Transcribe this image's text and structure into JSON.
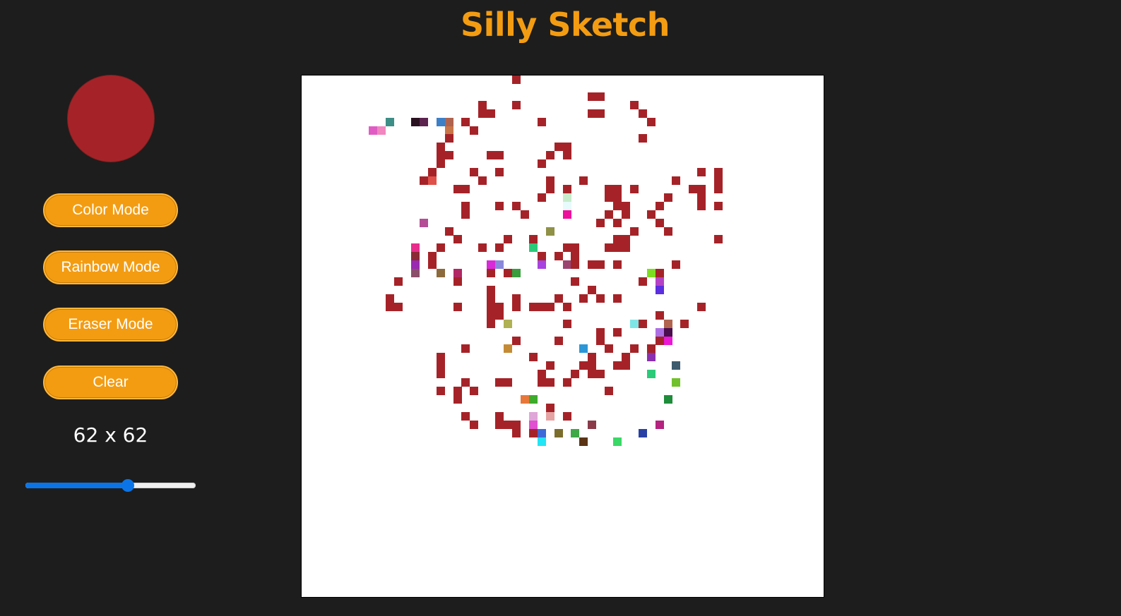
{
  "app": {
    "title": "Silly Sketch"
  },
  "sidebar": {
    "current_color": "#a52328",
    "buttons": {
      "color_mode": "Color Mode",
      "rainbow_mode": "Rainbow Mode",
      "eraser_mode": "Eraser Mode",
      "clear": "Clear"
    },
    "grid_size_label": "62 x 62",
    "grid_size_value": 62,
    "slider_fraction": 0.6
  },
  "theme": {
    "background": "#1d1d1d",
    "accent": "#f39c12",
    "canvas_background": "#ffffff",
    "brush_color": "#a52328",
    "slider_color": "#0b75e7"
  },
  "canvas": {
    "grid_size": 62,
    "painted_cells": [
      [
        25,
        0,
        "#a52328"
      ],
      [
        34,
        2,
        "#a52328"
      ],
      [
        35,
        2,
        "#a52328"
      ],
      [
        21,
        3,
        "#a52328"
      ],
      [
        25,
        3,
        "#a52328"
      ],
      [
        39,
        3,
        "#a52328"
      ],
      [
        21,
        4,
        "#a52328"
      ],
      [
        22,
        4,
        "#a52328"
      ],
      [
        34,
        4,
        "#a52328"
      ],
      [
        35,
        4,
        "#a52328"
      ],
      [
        40,
        4,
        "#a52328"
      ],
      [
        10,
        5,
        "#3d8e86"
      ],
      [
        13,
        5,
        "#2a1121"
      ],
      [
        14,
        5,
        "#5c234f"
      ],
      [
        16,
        5,
        "#3d80c7"
      ],
      [
        17,
        5,
        "#b0634f"
      ],
      [
        19,
        5,
        "#a52328"
      ],
      [
        28,
        5,
        "#a52328"
      ],
      [
        41,
        5,
        "#a52328"
      ],
      [
        8,
        6,
        "#e05cc4"
      ],
      [
        9,
        6,
        "#f186c0"
      ],
      [
        17,
        6,
        "#c87548"
      ],
      [
        20,
        6,
        "#a52328"
      ],
      [
        17,
        7,
        "#a52328"
      ],
      [
        40,
        7,
        "#a52328"
      ],
      [
        16,
        8,
        "#a52328"
      ],
      [
        30,
        8,
        "#a52328"
      ],
      [
        31,
        8,
        "#a52328"
      ],
      [
        16,
        9,
        "#a52328"
      ],
      [
        17,
        9,
        "#a52328"
      ],
      [
        22,
        9,
        "#a52328"
      ],
      [
        23,
        9,
        "#a52328"
      ],
      [
        29,
        9,
        "#a52328"
      ],
      [
        31,
        9,
        "#a52328"
      ],
      [
        16,
        10,
        "#a52328"
      ],
      [
        28,
        10,
        "#a52328"
      ],
      [
        15,
        11,
        "#a52328"
      ],
      [
        20,
        11,
        "#a52328"
      ],
      [
        23,
        11,
        "#a52328"
      ],
      [
        47,
        11,
        "#a52328"
      ],
      [
        49,
        11,
        "#a52328"
      ],
      [
        14,
        12,
        "#a52328"
      ],
      [
        15,
        12,
        "#e0504a"
      ],
      [
        21,
        12,
        "#a52328"
      ],
      [
        29,
        12,
        "#a52328"
      ],
      [
        33,
        12,
        "#a52328"
      ],
      [
        44,
        12,
        "#a52328"
      ],
      [
        49,
        12,
        "#a52328"
      ],
      [
        18,
        13,
        "#a52328"
      ],
      [
        19,
        13,
        "#a52328"
      ],
      [
        29,
        13,
        "#a52328"
      ],
      [
        31,
        13,
        "#a52328"
      ],
      [
        36,
        13,
        "#a52328"
      ],
      [
        37,
        13,
        "#a52328"
      ],
      [
        39,
        13,
        "#a52328"
      ],
      [
        46,
        13,
        "#a52328"
      ],
      [
        47,
        13,
        "#a52328"
      ],
      [
        49,
        13,
        "#a52328"
      ],
      [
        28,
        14,
        "#a52328"
      ],
      [
        31,
        14,
        "#c8eccb"
      ],
      [
        36,
        14,
        "#a52328"
      ],
      [
        37,
        14,
        "#a52328"
      ],
      [
        43,
        14,
        "#a52328"
      ],
      [
        47,
        14,
        "#a52328"
      ],
      [
        19,
        15,
        "#a52328"
      ],
      [
        23,
        15,
        "#a52328"
      ],
      [
        25,
        15,
        "#a52328"
      ],
      [
        31,
        15,
        "#e7fafc"
      ],
      [
        37,
        15,
        "#a52328"
      ],
      [
        38,
        15,
        "#a52328"
      ],
      [
        42,
        15,
        "#a52328"
      ],
      [
        47,
        15,
        "#a52328"
      ],
      [
        49,
        15,
        "#a52328"
      ],
      [
        19,
        16,
        "#a52328"
      ],
      [
        26,
        16,
        "#a52328"
      ],
      [
        31,
        16,
        "#ee109d"
      ],
      [
        36,
        16,
        "#a52328"
      ],
      [
        38,
        16,
        "#a52328"
      ],
      [
        41,
        16,
        "#a52328"
      ],
      [
        14,
        17,
        "#b44d95"
      ],
      [
        35,
        17,
        "#a52328"
      ],
      [
        37,
        17,
        "#a52328"
      ],
      [
        42,
        17,
        "#a52328"
      ],
      [
        17,
        18,
        "#a52328"
      ],
      [
        29,
        18,
        "#8f9146"
      ],
      [
        39,
        18,
        "#a52328"
      ],
      [
        43,
        18,
        "#a52328"
      ],
      [
        18,
        19,
        "#a52328"
      ],
      [
        24,
        19,
        "#a52328"
      ],
      [
        27,
        19,
        "#a52328"
      ],
      [
        37,
        19,
        "#a52328"
      ],
      [
        38,
        19,
        "#a52328"
      ],
      [
        49,
        19,
        "#a52328"
      ],
      [
        13,
        20,
        "#e82d8d"
      ],
      [
        16,
        20,
        "#a52328"
      ],
      [
        21,
        20,
        "#a52328"
      ],
      [
        23,
        20,
        "#a52328"
      ],
      [
        27,
        20,
        "#2bca79"
      ],
      [
        31,
        20,
        "#a52328"
      ],
      [
        32,
        20,
        "#a52328"
      ],
      [
        36,
        20,
        "#a52328"
      ],
      [
        37,
        20,
        "#a52328"
      ],
      [
        38,
        20,
        "#a52328"
      ],
      [
        13,
        21,
        "#8b2a34"
      ],
      [
        15,
        21,
        "#a52328"
      ],
      [
        28,
        21,
        "#a52328"
      ],
      [
        30,
        21,
        "#a52328"
      ],
      [
        32,
        21,
        "#a52328"
      ],
      [
        13,
        22,
        "#9a2ab2"
      ],
      [
        15,
        22,
        "#a52328"
      ],
      [
        22,
        22,
        "#d82ad9"
      ],
      [
        23,
        22,
        "#8a88dc"
      ],
      [
        28,
        22,
        "#a842e0"
      ],
      [
        31,
        22,
        "#9b4472"
      ],
      [
        32,
        22,
        "#a52328"
      ],
      [
        34,
        22,
        "#a52328"
      ],
      [
        35,
        22,
        "#a52328"
      ],
      [
        37,
        22,
        "#a52328"
      ],
      [
        44,
        22,
        "#a52328"
      ],
      [
        13,
        23,
        "#8b4e6a"
      ],
      [
        16,
        23,
        "#8d6a3b"
      ],
      [
        18,
        23,
        "#b22864"
      ],
      [
        22,
        23,
        "#a52328"
      ],
      [
        24,
        23,
        "#a52328"
      ],
      [
        25,
        23,
        "#3a9d3e"
      ],
      [
        41,
        23,
        "#7dde21"
      ],
      [
        42,
        23,
        "#a52328"
      ],
      [
        11,
        24,
        "#a52328"
      ],
      [
        18,
        24,
        "#a52328"
      ],
      [
        32,
        24,
        "#a52328"
      ],
      [
        40,
        24,
        "#a52328"
      ],
      [
        42,
        24,
        "#b542c5"
      ],
      [
        22,
        25,
        "#a52328"
      ],
      [
        34,
        25,
        "#a52328"
      ],
      [
        42,
        25,
        "#5b2ee0"
      ],
      [
        10,
        26,
        "#a52328"
      ],
      [
        22,
        26,
        "#a52328"
      ],
      [
        25,
        26,
        "#a52328"
      ],
      [
        30,
        26,
        "#a52328"
      ],
      [
        33,
        26,
        "#a52328"
      ],
      [
        35,
        26,
        "#a52328"
      ],
      [
        37,
        26,
        "#a52328"
      ],
      [
        10,
        27,
        "#a52328"
      ],
      [
        11,
        27,
        "#a52328"
      ],
      [
        18,
        27,
        "#a52328"
      ],
      [
        22,
        27,
        "#a52328"
      ],
      [
        23,
        27,
        "#a52328"
      ],
      [
        25,
        27,
        "#a52328"
      ],
      [
        27,
        27,
        "#a52328"
      ],
      [
        28,
        27,
        "#a52328"
      ],
      [
        29,
        27,
        "#a52328"
      ],
      [
        31,
        27,
        "#a52328"
      ],
      [
        47,
        27,
        "#a52328"
      ],
      [
        22,
        28,
        "#a52328"
      ],
      [
        23,
        28,
        "#a52328"
      ],
      [
        42,
        28,
        "#a52328"
      ],
      [
        22,
        29,
        "#a52328"
      ],
      [
        24,
        29,
        "#b0b152"
      ],
      [
        31,
        29,
        "#a52328"
      ],
      [
        39,
        29,
        "#7ee5e6"
      ],
      [
        40,
        29,
        "#a52328"
      ],
      [
        43,
        29,
        "#b0634f"
      ],
      [
        45,
        29,
        "#a52328"
      ],
      [
        35,
        30,
        "#a52328"
      ],
      [
        37,
        30,
        "#a52328"
      ],
      [
        42,
        30,
        "#ad70e4"
      ],
      [
        43,
        30,
        "#4a0d4e"
      ],
      [
        25,
        31,
        "#a52328"
      ],
      [
        30,
        31,
        "#a52328"
      ],
      [
        35,
        31,
        "#a52328"
      ],
      [
        42,
        31,
        "#a52328"
      ],
      [
        43,
        31,
        "#ea18d4"
      ],
      [
        19,
        32,
        "#a52328"
      ],
      [
        24,
        32,
        "#c58b34"
      ],
      [
        33,
        32,
        "#2b97d7"
      ],
      [
        36,
        32,
        "#a52328"
      ],
      [
        39,
        32,
        "#a52328"
      ],
      [
        41,
        32,
        "#a52328"
      ],
      [
        16,
        33,
        "#a52328"
      ],
      [
        27,
        33,
        "#a52328"
      ],
      [
        34,
        33,
        "#a52328"
      ],
      [
        38,
        33,
        "#a52328"
      ],
      [
        41,
        33,
        "#8a30b0"
      ],
      [
        16,
        34,
        "#a52328"
      ],
      [
        29,
        34,
        "#a52328"
      ],
      [
        33,
        34,
        "#a52328"
      ],
      [
        34,
        34,
        "#a52328"
      ],
      [
        37,
        34,
        "#a52328"
      ],
      [
        38,
        34,
        "#a52328"
      ],
      [
        44,
        34,
        "#3e5b6e"
      ],
      [
        16,
        35,
        "#a52328"
      ],
      [
        28,
        35,
        "#a52328"
      ],
      [
        32,
        35,
        "#a52328"
      ],
      [
        34,
        35,
        "#a52328"
      ],
      [
        35,
        35,
        "#a52328"
      ],
      [
        41,
        35,
        "#2bca79"
      ],
      [
        19,
        36,
        "#a52328"
      ],
      [
        23,
        36,
        "#a52328"
      ],
      [
        24,
        36,
        "#a52328"
      ],
      [
        28,
        36,
        "#a52328"
      ],
      [
        29,
        36,
        "#a52328"
      ],
      [
        31,
        36,
        "#a52328"
      ],
      [
        44,
        36,
        "#71c12b"
      ],
      [
        16,
        37,
        "#a52328"
      ],
      [
        18,
        37,
        "#a52328"
      ],
      [
        20,
        37,
        "#a52328"
      ],
      [
        36,
        37,
        "#a52328"
      ],
      [
        18,
        38,
        "#a52328"
      ],
      [
        26,
        38,
        "#e8773a"
      ],
      [
        27,
        38,
        "#3dab2b"
      ],
      [
        43,
        38,
        "#1e8c3a"
      ],
      [
        29,
        39,
        "#a52328"
      ],
      [
        19,
        40,
        "#a52328"
      ],
      [
        23,
        40,
        "#a52328"
      ],
      [
        27,
        40,
        "#dfa6d8"
      ],
      [
        29,
        40,
        "#e6a3a3"
      ],
      [
        31,
        40,
        "#a52328"
      ],
      [
        20,
        41,
        "#a52328"
      ],
      [
        23,
        41,
        "#a52328"
      ],
      [
        24,
        41,
        "#a52328"
      ],
      [
        25,
        41,
        "#a52328"
      ],
      [
        27,
        41,
        "#e050d0"
      ],
      [
        34,
        41,
        "#8b3a4a"
      ],
      [
        42,
        41,
        "#b5227f"
      ],
      [
        25,
        42,
        "#a52328"
      ],
      [
        27,
        42,
        "#a52328"
      ],
      [
        28,
        42,
        "#3d6ad8"
      ],
      [
        30,
        42,
        "#7b6e2c"
      ],
      [
        32,
        42,
        "#3fa847"
      ],
      [
        40,
        42,
        "#2941a5"
      ],
      [
        28,
        43,
        "#22e5f5"
      ],
      [
        33,
        43,
        "#5b3415"
      ],
      [
        37,
        43,
        "#3ad866"
      ]
    ]
  }
}
